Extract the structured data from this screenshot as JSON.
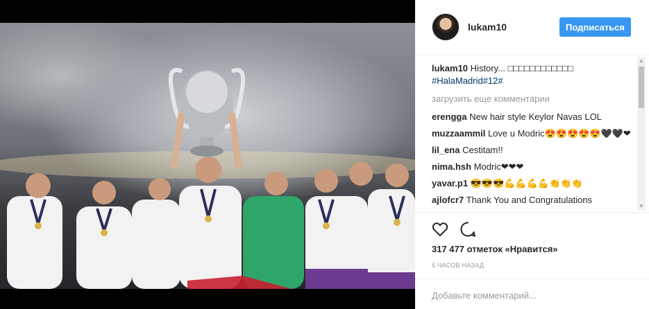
{
  "post": {
    "username": "lukam10",
    "follow_label": "Подписаться",
    "caption": {
      "user": "lukam10",
      "text": "History... □□□□□□□□□□□□",
      "hashtags": "#HalaMadrid#12#"
    },
    "load_more": "загрузить еще комментарии",
    "comments": [
      {
        "user": "erengga",
        "text": "New hair style Keylor Navas LOL"
      },
      {
        "user": "muzzaammil",
        "text": "Love u Modric😍😍😍😍😍🖤🖤❤"
      },
      {
        "user": "lil_ena",
        "text": "Cestitam!!"
      },
      {
        "user": "nima.hsh",
        "text": "Modric❤❤❤"
      },
      {
        "user": "yavar.p1",
        "text": "😎😎😎💪💪💪💪👏👏👏"
      },
      {
        "user": "ajlofcr7",
        "text": "Thank You and Congratulations"
      }
    ],
    "likes": "317 477 отметок «Нравится»",
    "timestamp": "5 ЧАСОВ НАЗАД",
    "add_comment_placeholder": "Добавьте комментарий...",
    "follow_color": "#3897f0",
    "icons": [
      "heart-icon",
      "comment-icon"
    ]
  }
}
